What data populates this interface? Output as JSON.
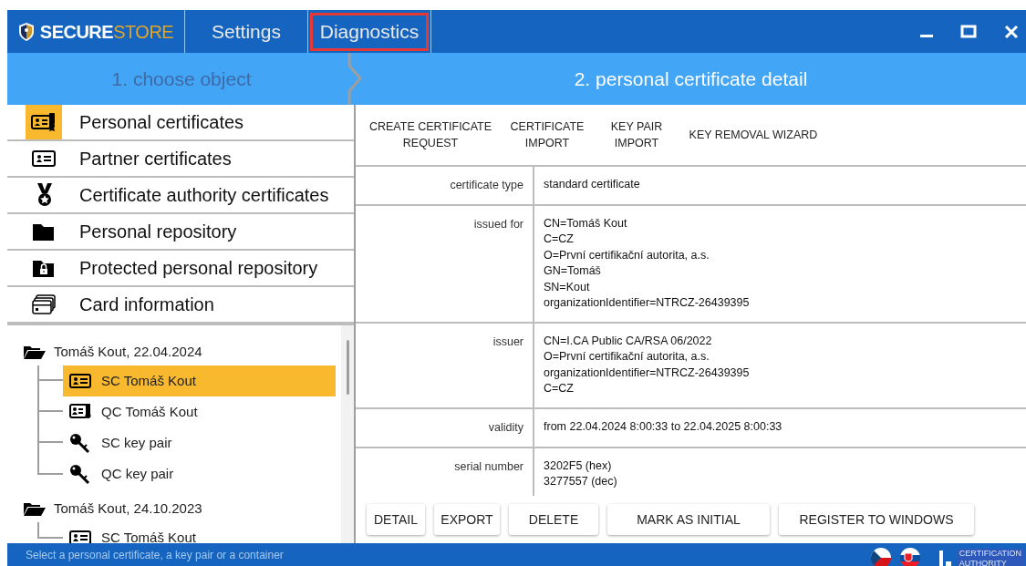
{
  "window": {
    "logo_primary": "SECURE",
    "logo_secondary": "STORE"
  },
  "menu": [
    {
      "label": "Settings",
      "highlighted": false
    },
    {
      "label": "Diagnostics",
      "highlighted": true
    }
  ],
  "steps": [
    {
      "label": "1. choose object",
      "selected": false
    },
    {
      "label": "2. personal certificate detail",
      "selected": true
    }
  ],
  "categories": [
    {
      "label": "Personal certificates",
      "kind": "personal",
      "selected": true
    },
    {
      "label": "Partner certificates",
      "kind": "partner",
      "selected": false
    },
    {
      "label": "Certificate authority certificates",
      "kind": "authority",
      "selected": false
    },
    {
      "label": "Personal repository",
      "kind": "repository",
      "selected": false
    },
    {
      "label": "Protected personal repository",
      "kind": "protected",
      "selected": false
    },
    {
      "label": "Card information",
      "kind": "card",
      "selected": false
    }
  ],
  "tree": [
    {
      "label": "Tomáš Kout, 22.04.2024",
      "kind": "folder",
      "children": [
        {
          "label": "SC Tomáš Kout",
          "kind": "cert",
          "selected": true
        },
        {
          "label": "QC Tomáš Kout",
          "kind": "qcert",
          "selected": false
        },
        {
          "label": "SC key pair",
          "kind": "key",
          "selected": false
        },
        {
          "label": "QC key pair",
          "kind": "key",
          "selected": false
        }
      ]
    },
    {
      "label": "Tomáš Kout, 24.10.2023",
      "kind": "folder",
      "children": [
        {
          "label": "SC Tomáš Kout",
          "kind": "cert",
          "selected": false
        }
      ]
    }
  ],
  "actions": [
    "CREATE CERTIFICATE\nREQUEST",
    "CERTIFICATE\nIMPORT",
    "KEY PAIR\nIMPORT",
    "KEY REMOVAL WIZARD"
  ],
  "details": [
    {
      "label": "certificate type",
      "lines": [
        "standard certificate"
      ]
    },
    {
      "label": "issued for",
      "lines": [
        "CN=Tomáš Kout",
        "C=CZ",
        "O=První certifikační autorita, a.s.",
        "GN=Tomáš",
        "SN=Kout",
        "organizationIdentifier=NTRCZ-26439395"
      ]
    },
    {
      "label": "issuer",
      "lines": [
        "CN=I.CA Public CA/RSA 06/2022",
        "O=První certifikační autorita, a.s.",
        "organizationIdentifier=NTRCZ-26439395",
        "C=CZ"
      ]
    },
    {
      "label": "validity",
      "lines": [
        "from 22.04.2024 8:00:33 to 22.04.2025 8:00:33"
      ]
    },
    {
      "label": "serial number",
      "lines": [
        "3202F5 (hex)",
        "3277557 (dec)"
      ]
    }
  ],
  "buttons": [
    "DETAIL",
    "EXPORT",
    "DELETE",
    "MARK AS INITIAL",
    "REGISTER TO WINDOWS"
  ],
  "status_bar": {
    "text": "Select a personal certificate, a key pair or a container",
    "ca_logo": [
      "CERTIFICATION",
      "AUTHORITY"
    ]
  }
}
